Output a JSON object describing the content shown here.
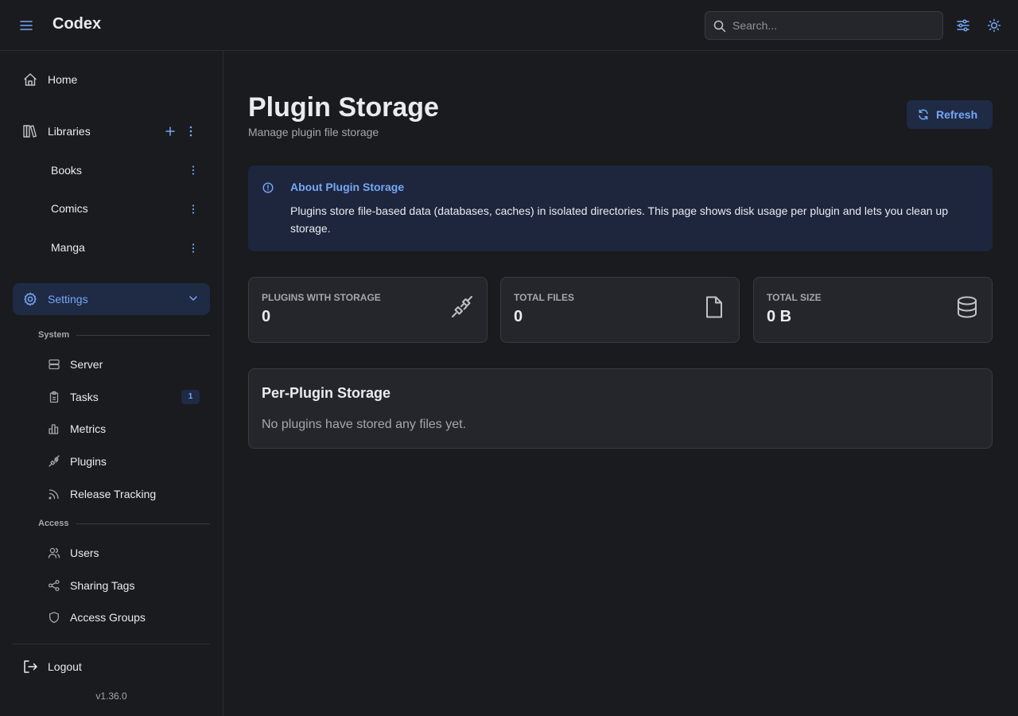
{
  "app": {
    "name": "Codex",
    "version": "v1.36.0"
  },
  "header": {
    "search_placeholder": "Search..."
  },
  "sidebar": {
    "home": "Home",
    "libraries": {
      "label": "Libraries",
      "items": [
        "Books",
        "Comics",
        "Manga"
      ]
    },
    "settings": {
      "label": "Settings",
      "sections": [
        {
          "label": "System",
          "items": [
            {
              "label": "Server",
              "icon": "server-icon"
            },
            {
              "label": "Tasks",
              "icon": "clipboard-icon",
              "badge": "1"
            },
            {
              "label": "Metrics",
              "icon": "bar-chart-icon"
            },
            {
              "label": "Plugins",
              "icon": "plug-icon"
            },
            {
              "label": "Release Tracking",
              "icon": "rss-icon"
            }
          ]
        },
        {
          "label": "Access",
          "items": [
            {
              "label": "Users",
              "icon": "users-icon"
            },
            {
              "label": "Sharing Tags",
              "icon": "share-icon"
            },
            {
              "label": "Access Groups",
              "icon": "shield-icon"
            }
          ]
        }
      ]
    },
    "logout": "Logout"
  },
  "main": {
    "title": "Plugin Storage",
    "subtitle": "Manage plugin file storage",
    "refresh_label": "Refresh",
    "alert": {
      "title": "About Plugin Storage",
      "text": "Plugins store file-based data (databases, caches) in isolated directories. This page shows disk usage per plugin and lets you clean up storage."
    },
    "stats": [
      {
        "label": "PLUGINS WITH STORAGE",
        "value": "0",
        "icon": "plug-icon"
      },
      {
        "label": "TOTAL FILES",
        "value": "0",
        "icon": "file-icon"
      },
      {
        "label": "TOTAL SIZE",
        "value": "0 B",
        "icon": "database-icon"
      }
    ],
    "per_plugin": {
      "title": "Per-Plugin Storage",
      "empty": "No plugins have stored any files yet."
    }
  },
  "colors": {
    "accent": "#74a8f7",
    "background": "#1a1b1e",
    "card": "#25262b",
    "active_bg": "#1f2a44"
  }
}
